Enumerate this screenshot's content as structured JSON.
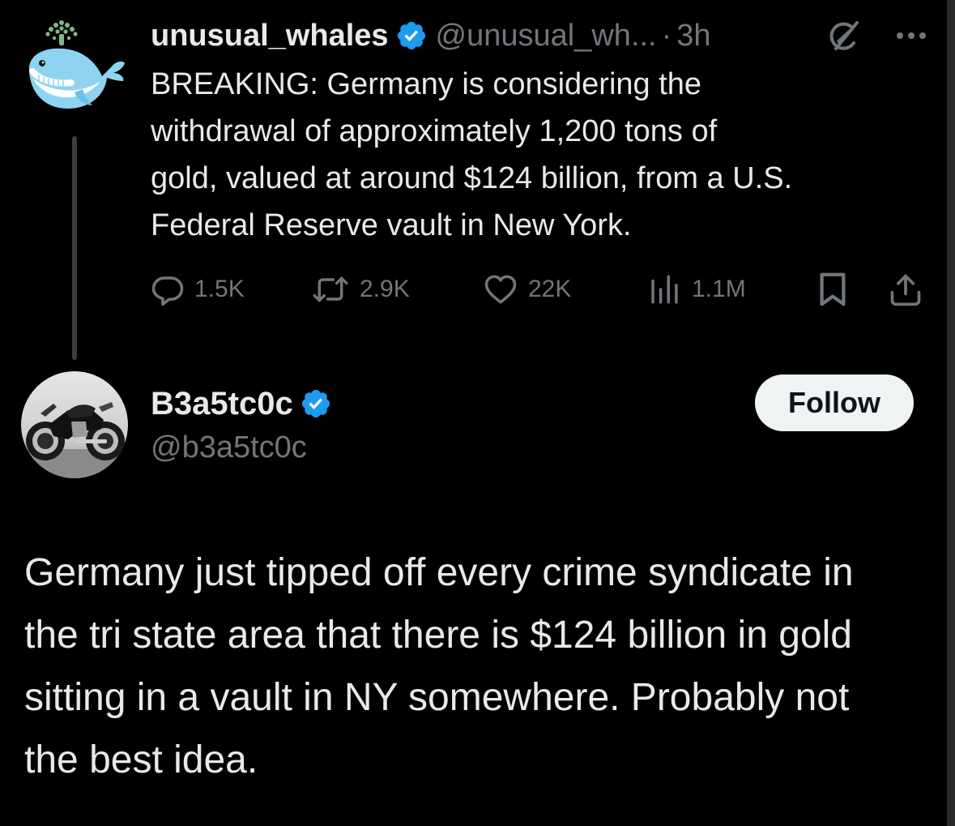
{
  "parent_tweet": {
    "avatar_icon": "whale-icon",
    "display_name": "unusual_whales",
    "verified": true,
    "handle": "@unusual_wh...",
    "separator": "·",
    "time": "3h",
    "text": "BREAKING: Germany is considering the\nwithdrawal of approximately 1,200 tons of\ngold, valued at around $124 billion, from a U.S.\nFederal Reserve vault in New York.",
    "actions": {
      "replies": "1.5K",
      "reposts": "2.9K",
      "likes": "22K",
      "views": "1.1M"
    }
  },
  "reply": {
    "avatar_icon": "motorcycle-avatar",
    "display_name": "B3a5tc0c",
    "verified": true,
    "handle": "@b3a5tc0c",
    "follow_label": "Follow",
    "text": "Germany just tipped off every crime syndicate in\nthe tri state area that there is $124 billion in gold\nsitting in a vault in NY somewhere. Probably not\nthe best idea."
  },
  "colors": {
    "background": "#000000",
    "text_primary": "#e7e9ea",
    "text_secondary": "#71767b",
    "verified_blue": "#1d9bf0",
    "whale_blue": "#8fd3f2",
    "whale_spout": "#7fb88a"
  }
}
